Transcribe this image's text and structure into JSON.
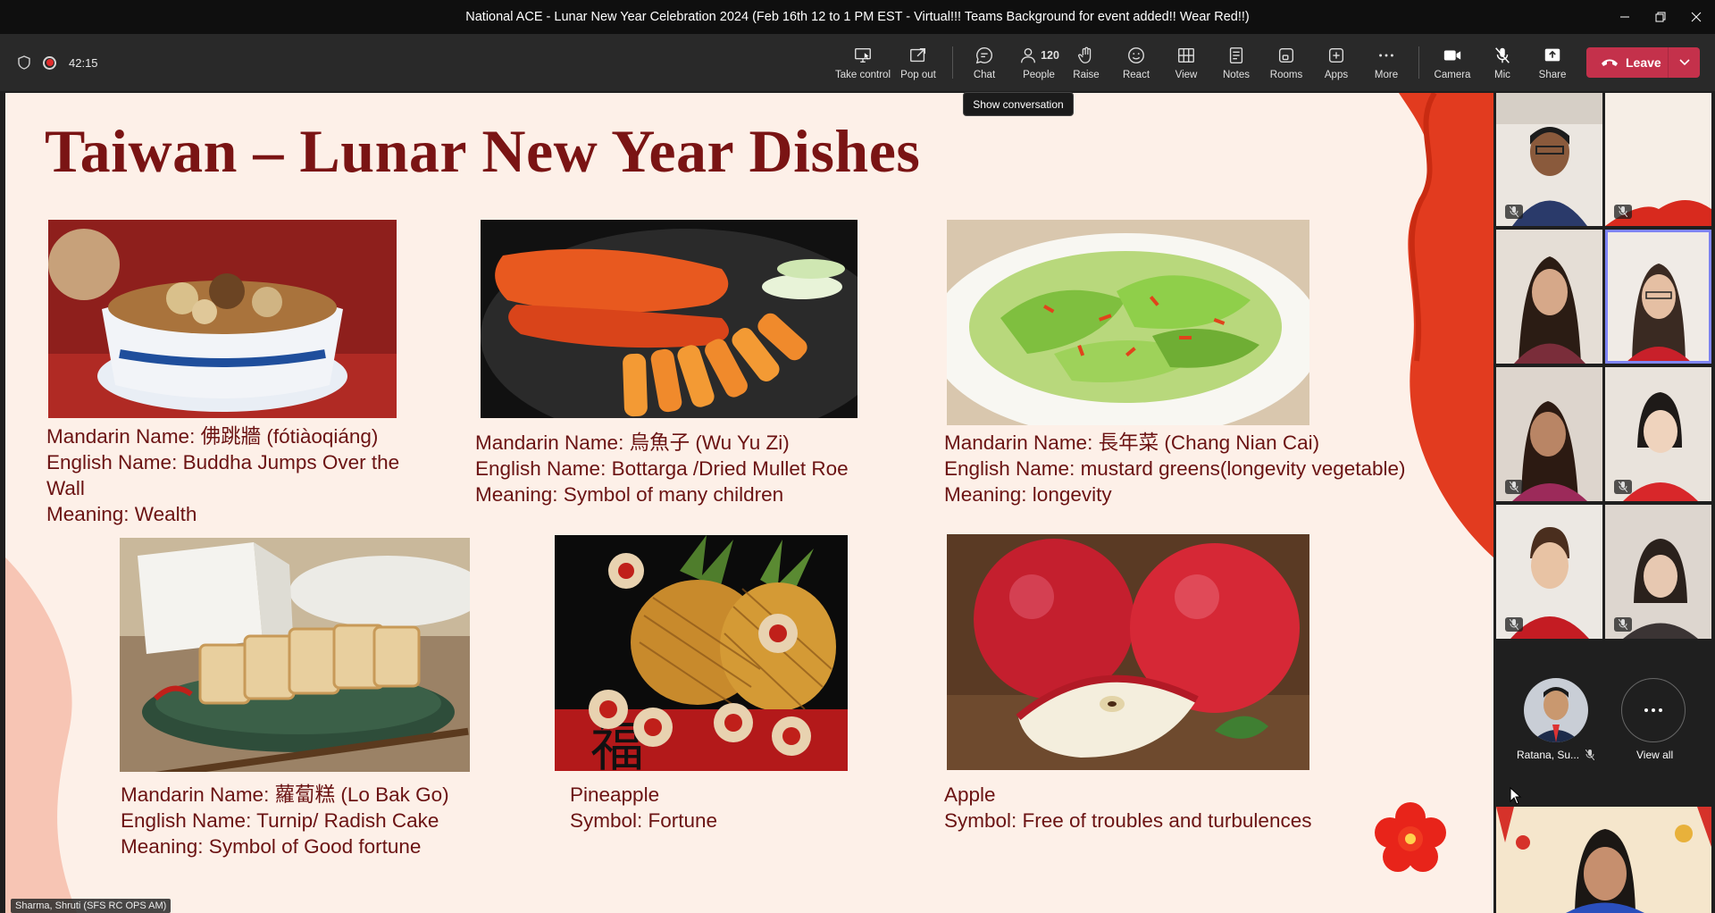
{
  "window": {
    "title": "National ACE - Lunar New Year Celebration 2024 (Feb 16th 12 to 1 PM EST - Virtual!!! Teams Background for event added!! Wear Red!!)"
  },
  "meeting": {
    "timer": "42:15",
    "recording": true
  },
  "toolbar": {
    "take_control": "Take control",
    "pop_out": "Pop out",
    "chat": "Chat",
    "people": "People",
    "people_count": "120",
    "raise": "Raise",
    "react": "React",
    "view": "View",
    "notes": "Notes",
    "rooms": "Rooms",
    "apps": "Apps",
    "more": "More",
    "camera": "Camera",
    "mic": "Mic",
    "share": "Share",
    "leave": "Leave"
  },
  "tooltip": "Show conversation",
  "slide": {
    "title": "Taiwan – Lunar New Year Dishes",
    "dishes": [
      {
        "lines": [
          "Mandarin Name: 佛跳牆 (fótiàoqiáng)",
          "English Name: Buddha Jumps Over the",
          "Wall",
          "Meaning: Wealth"
        ]
      },
      {
        "lines": [
          "Mandarin Name: 烏魚子 (Wu Yu Zi)",
          "English Name: Bottarga /Dried Mullet Roe",
          "Meaning: Symbol of many children"
        ]
      },
      {
        "lines": [
          "Mandarin Name: 長年菜 (Chang Nian Cai)",
          "English Name: mustard greens(longevity vegetable)",
          "Meaning: longevity"
        ]
      },
      {
        "lines": [
          "Mandarin Name: 蘿蔔糕 (Lo Bak Go)",
          "English Name: Turnip/ Radish Cake",
          "Meaning:  Symbol of Good fortune"
        ]
      },
      {
        "lines": [
          "Pineapple",
          "Symbol: Fortune"
        ]
      },
      {
        "lines": [
          "Apple",
          "Symbol: Free of troubles and turbulences"
        ]
      }
    ]
  },
  "presenter_label": "Sharma, Shruti (SFS RC OPS AM)",
  "gallery": {
    "avatar_name": "Ratana, Su...",
    "view_all": "View all"
  },
  "colors": {
    "slide_title": "#7a1414",
    "caption": "#6b1313",
    "leave_button": "#c4314b",
    "speaking_outline": "#7f85f5"
  }
}
